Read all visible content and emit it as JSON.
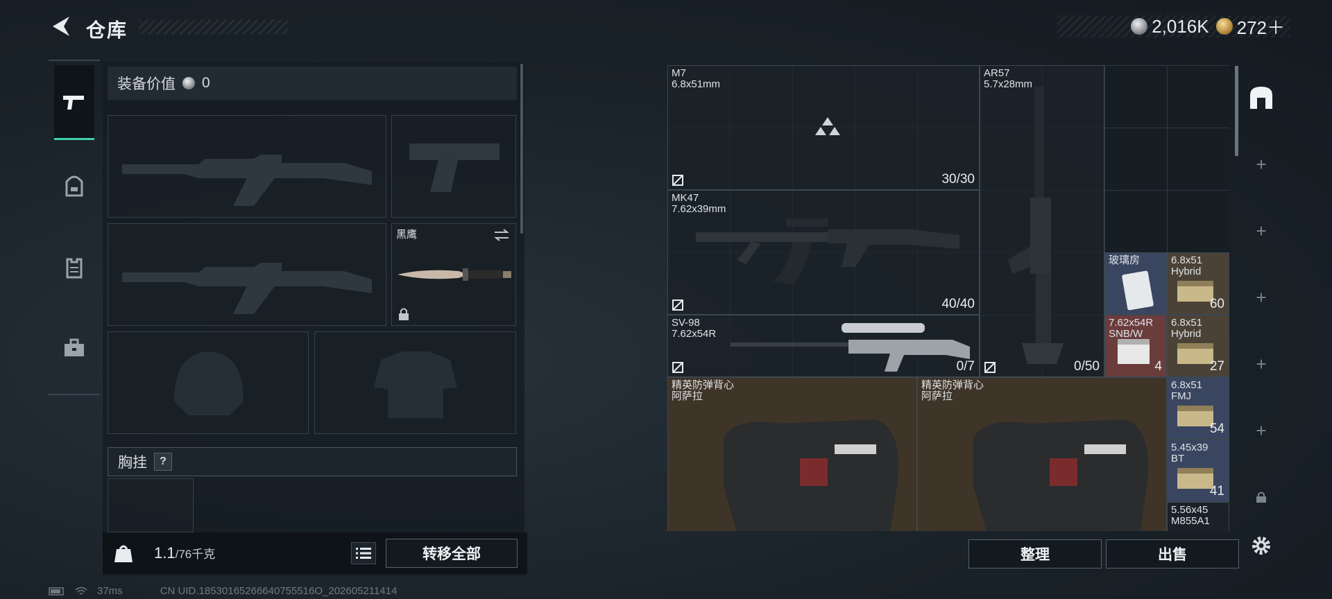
{
  "header": {
    "title": "仓库",
    "back_icon": "back-arrow-icon"
  },
  "currency": [
    {
      "icon": "silver-coin-icon",
      "value": "2,016K"
    },
    {
      "icon": "gold-coin-icon",
      "value": "272＋"
    }
  ],
  "tabs": [
    {
      "name": "weapon",
      "icon": "pistol-icon",
      "active": true
    },
    {
      "name": "backpack",
      "icon": "backpack-icon",
      "active": false
    },
    {
      "name": "armor",
      "icon": "vest-icon",
      "active": false
    },
    {
      "name": "case",
      "icon": "briefcase-icon",
      "active": false
    }
  ],
  "loadout": {
    "value_label": "装备价值",
    "value": "0",
    "knife_name": "黑鹰",
    "chest_label": "胸挂",
    "help_glyph": "?",
    "weight_current": "1.1",
    "weight_max": "/76千克",
    "weight_icon_text": "KG",
    "transfer_all": "转移全部"
  },
  "stash": {
    "items": [
      {
        "id": "m7",
        "name": "M7\n6.8x51mm",
        "count": "30/30"
      },
      {
        "id": "ar57",
        "name": "AR57\n5.7x28mm",
        "count": "0/50"
      },
      {
        "id": "mk47",
        "name": "MK47\n7.62x39mm",
        "count": "40/40"
      },
      {
        "id": "sv98",
        "name": "SV-98\n7.62x54R",
        "count": "0/7"
      },
      {
        "id": "glass",
        "name": "玻璃房",
        "count": ""
      },
      {
        "id": "ammo1",
        "name": "6.8x51\nHybrid",
        "count": "60"
      },
      {
        "id": "ammo2",
        "name": "7.62x54R\nSNB/W",
        "count": "4"
      },
      {
        "id": "ammo3",
        "name": "6.8x51\nHybrid",
        "count": "27"
      },
      {
        "id": "vest1",
        "name": "精英防弹背心\n阿萨拉",
        "count": ""
      },
      {
        "id": "vest2",
        "name": "精英防弹背心\n阿萨拉",
        "count": ""
      },
      {
        "id": "ammo4",
        "name": "6.8x51\nFMJ",
        "count": "54"
      },
      {
        "id": "ammo5",
        "name": "5.45x39\nBT",
        "count": "41"
      },
      {
        "id": "ammo6",
        "name": "5.56x45\nM855A1",
        "count": ""
      }
    ],
    "sort_button": "整理",
    "sell_button": "出售"
  },
  "sidebar": {
    "plus": "+"
  },
  "status": {
    "ping": "37ms",
    "uid": "CN UID.18530165266640755516O_202605211414"
  }
}
